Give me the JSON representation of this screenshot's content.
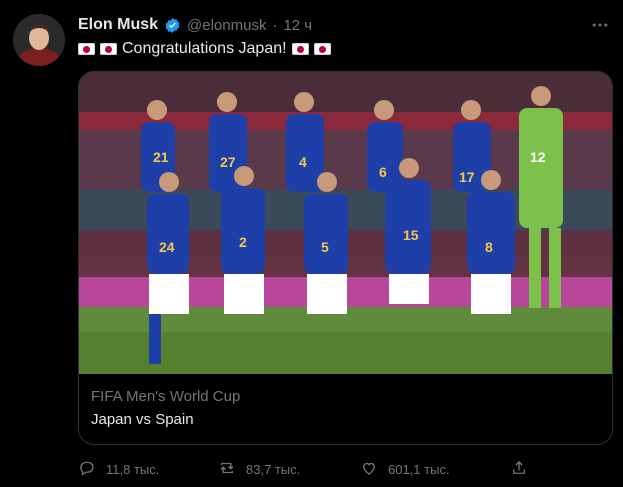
{
  "tweet": {
    "author": {
      "display_name": "Elon Musk",
      "handle": "@elonmusk",
      "separator": "·",
      "time": "12 ч",
      "verified_icon": "verified-badge-icon",
      "avatar_icon": "avatar"
    },
    "text": "Congratulations Japan!",
    "more_icon": "more-horizontal-icon"
  },
  "card": {
    "source": "FIFA Men's World Cup",
    "title": "Japan vs Spain",
    "image_icon": "team-photo-image"
  },
  "actions": {
    "reply": {
      "count": "11,8 тыс.",
      "icon": "reply-icon"
    },
    "retweet": {
      "count": "83,7 тыс.",
      "icon": "retweet-icon"
    },
    "like": {
      "count": "601,1 тыс.",
      "icon": "like-icon"
    },
    "share": {
      "icon": "share-icon"
    }
  },
  "colors": {
    "background": "#000000",
    "text_primary": "#e7e9ea",
    "text_secondary": "#71767b",
    "border": "#2f3336",
    "verified": "#1d9bf0",
    "japan_red": "#bc002d",
    "jersey_blue": "#1f3fa8"
  }
}
